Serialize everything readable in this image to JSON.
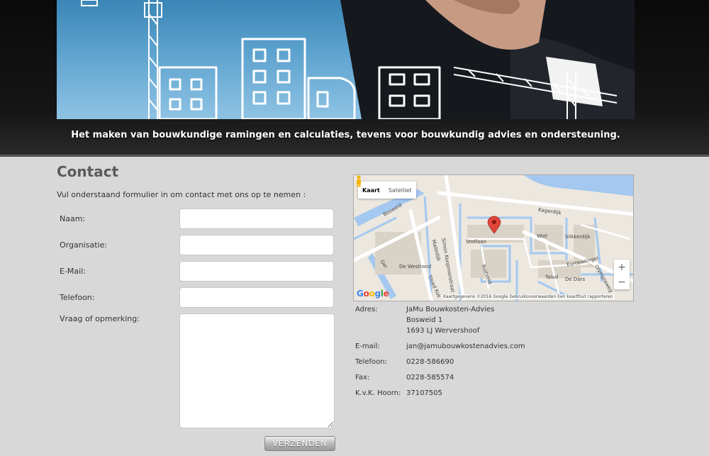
{
  "banner": {
    "tagline": "Het maken van bouwkundige ramingen en calculaties, tevens voor bouwkundig advies en ondersteuning."
  },
  "contact": {
    "title": "Contact",
    "intro": "Vul onderstaand formulier in om contact met ons op te nemen :",
    "fields": [
      {
        "label": "Naam:",
        "value": ""
      },
      {
        "label": "Organisatie:",
        "value": ""
      },
      {
        "label": "E-Mail:",
        "value": ""
      },
      {
        "label": "Telefoon:",
        "value": ""
      }
    ],
    "message_label": "Vraag of opmerking:",
    "message_value": "",
    "submit_label": "VERZENDEN"
  },
  "map": {
    "type_map": "Kaart",
    "type_satellite": "Satelliet",
    "zoom_in": "+",
    "zoom_out": "−",
    "google": "Google",
    "attribution": "Kaartgegevens ©2016 Google    Gebruiksvoorwaarden    Een kaartfout rapporteren",
    "street_labels": {
      "kagerdijk": "Kagerdijk",
      "simon": "Simon Koopmanstraat",
      "stolfaan": "Stolfaan",
      "westrand": "De Westrand",
      "wiel": "Wiel",
      "slikkerdijk": "Slikkerdijk",
      "europasingel": "Europasingel",
      "olympiaweg": "Olympiaweg",
      "talud": "Talud",
      "dars": "De Dars",
      "rietveld": "Rietveld",
      "malledijk": "Malledijk",
      "thiedkok": "Thied Kok",
      "ger": "Ger",
      "bosweid": "Bosweid"
    },
    "colors": {
      "water": "#a4c8f0",
      "road": "#ffffff",
      "land": "#ece7df",
      "block": "#d9d2c6",
      "marker": "#e0453a"
    }
  },
  "info": {
    "address_label": "Adres:",
    "company": "JaMu Bouwkosten-Advies",
    "street": "Bosweid 1",
    "city": "1693 LJ Wervershoof",
    "email_label": "E-mail:",
    "email": "jan@jamubouwkostenadvies.com",
    "phone_label": "Telefoon:",
    "phone": "0228-586690",
    "fax_label": "Fax:",
    "fax": "0228-585574",
    "kvk_label": "K.v.K. Hoorn:",
    "kvk": "37107505"
  }
}
